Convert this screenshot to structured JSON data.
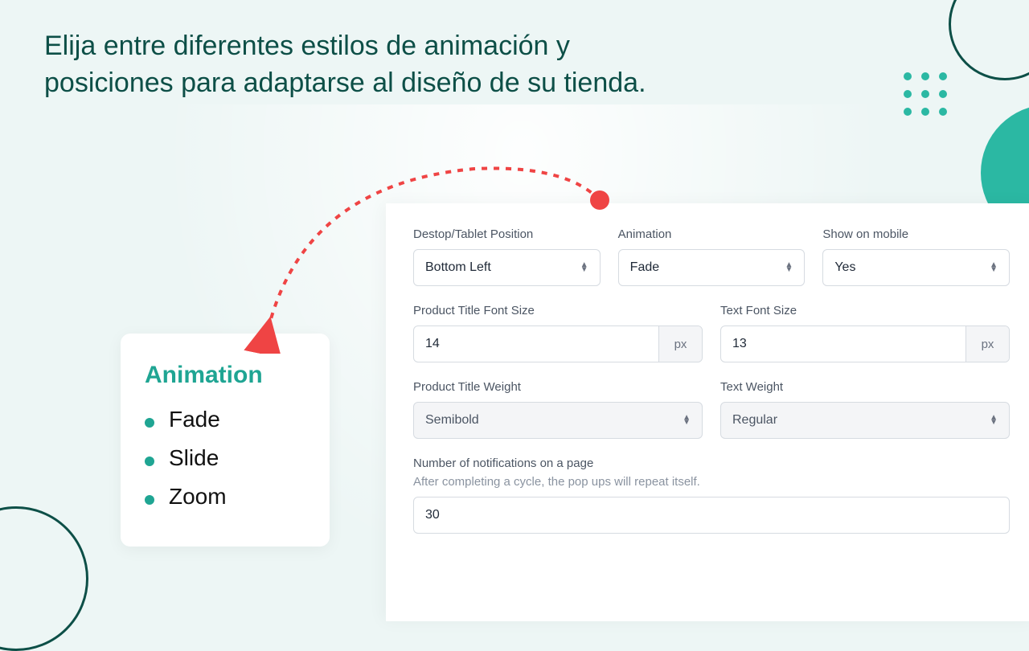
{
  "headline": "Elija entre diferentes estilos de animación y posiciones para adaptarse al diseño de su tienda.",
  "animCard": {
    "title": "Animation",
    "items": [
      "Fade",
      "Slide",
      "Zoom"
    ]
  },
  "settings": {
    "position": {
      "label": "Destop/Tablet Position",
      "value": "Bottom Left"
    },
    "animation": {
      "label": "Animation",
      "value": "Fade"
    },
    "showMobile": {
      "label": "Show on mobile",
      "value": "Yes"
    },
    "titleFontSize": {
      "label": "Product Title Font Size",
      "value": "14",
      "unit": "px"
    },
    "textFontSize": {
      "label": "Text Font Size",
      "value": "13",
      "unit": "px"
    },
    "titleWeight": {
      "label": "Product Title Weight",
      "value": "Semibold"
    },
    "textWeight": {
      "label": "Text Weight",
      "value": "Regular"
    },
    "notifications": {
      "label": "Number of notifications on a page",
      "hint": "After completing a cycle, the pop ups will repeat itself.",
      "value": "30"
    }
  }
}
